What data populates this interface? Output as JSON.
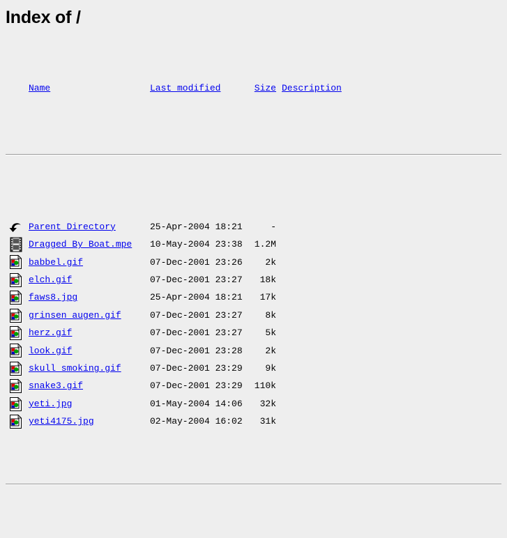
{
  "page": {
    "title": "Index of /"
  },
  "table": {
    "headers": {
      "icon": "",
      "name": "Name",
      "last_modified": "Last modified",
      "size": "Size",
      "description": "Description"
    },
    "rows": [
      {
        "icon": "back-arrow-icon",
        "name": "Parent Directory",
        "last_modified": "25-Apr-2004 18:21",
        "size": "-",
        "description": ""
      },
      {
        "icon": "movie-film-icon",
        "name": "Dragged By Boat.mpe",
        "last_modified": "10-May-2004 23:38",
        "size": "1.2M",
        "description": ""
      },
      {
        "icon": "image-file-icon",
        "name": "babbel.gif",
        "last_modified": "07-Dec-2001 23:26",
        "size": "2k",
        "description": ""
      },
      {
        "icon": "image-file-icon",
        "name": "elch.gif",
        "last_modified": "07-Dec-2001 23:27",
        "size": "18k",
        "description": ""
      },
      {
        "icon": "image-file-icon",
        "name": "faws8.jpg",
        "last_modified": "25-Apr-2004 18:21",
        "size": "17k",
        "description": ""
      },
      {
        "icon": "image-file-icon",
        "name": "grinsen augen.gif",
        "last_modified": "07-Dec-2001 23:27",
        "size": "8k",
        "description": ""
      },
      {
        "icon": "image-file-icon",
        "name": "herz.gif",
        "last_modified": "07-Dec-2001 23:27",
        "size": "5k",
        "description": ""
      },
      {
        "icon": "image-file-icon",
        "name": "look.gif",
        "last_modified": "07-Dec-2001 23:28",
        "size": "2k",
        "description": ""
      },
      {
        "icon": "image-file-icon",
        "name": "skull smoking.gif",
        "last_modified": "07-Dec-2001 23:29",
        "size": "9k",
        "description": ""
      },
      {
        "icon": "image-file-icon",
        "name": "snake3.gif",
        "last_modified": "07-Dec-2001 23:29",
        "size": "110k",
        "description": ""
      },
      {
        "icon": "image-file-icon",
        "name": "yeti.jpg",
        "last_modified": "01-May-2004 14:06",
        "size": "32k",
        "description": ""
      },
      {
        "icon": "image-file-icon",
        "name": "yeti4175.jpg",
        "last_modified": "02-May-2004 16:02",
        "size": "31k",
        "description": ""
      }
    ]
  },
  "colors": {
    "background": "#eeeeee",
    "link": "#0000ee",
    "text": "#000000",
    "rule": "#9a9a9a"
  }
}
